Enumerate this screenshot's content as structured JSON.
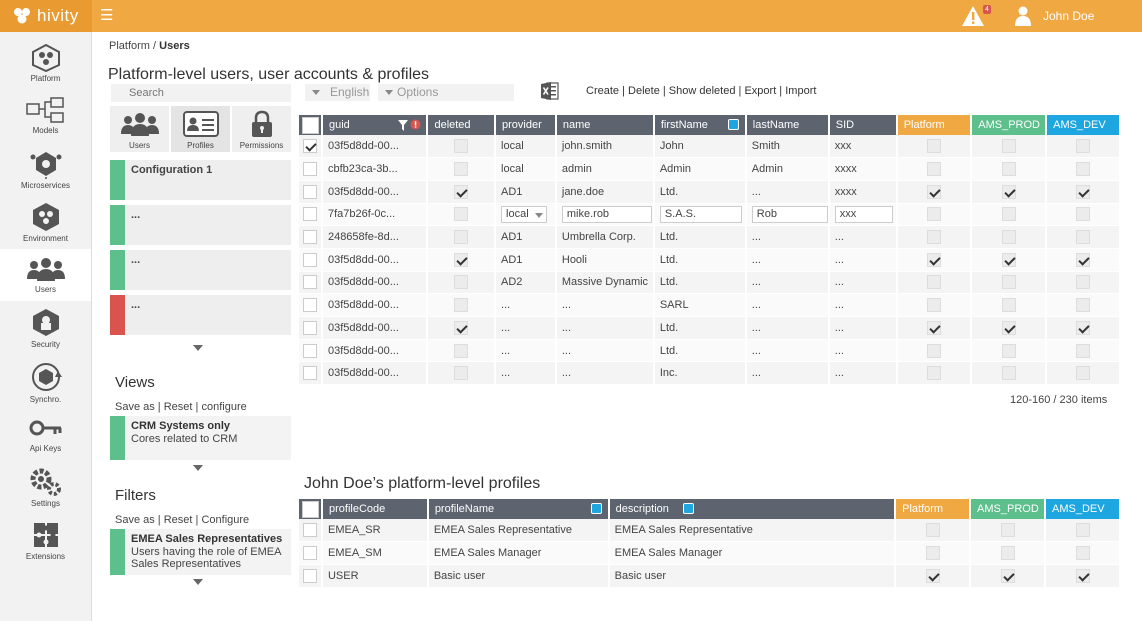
{
  "app": {
    "brand": "hivity",
    "username": "John Doe",
    "alert_count": "4"
  },
  "colors": {
    "topbar": "#f0a843",
    "platform": "#f0a843",
    "ams_prod": "#5cbf8c",
    "ams_dev": "#1da6e0",
    "header": "#5d6470",
    "danger": "#d9534f"
  },
  "sidebar": {
    "items": [
      {
        "label": "Platform",
        "icon": "platform-icon"
      },
      {
        "label": "Models",
        "icon": "models-icon"
      },
      {
        "label": "Microservices",
        "icon": "microservices-icon"
      },
      {
        "label": "Environment",
        "icon": "environment-icon"
      },
      {
        "label": "Users",
        "icon": "users-icon",
        "active": true
      },
      {
        "label": "Security",
        "icon": "security-icon"
      },
      {
        "label": "Synchro.",
        "icon": "synchro-icon"
      },
      {
        "label": "Api Keys",
        "icon": "key-icon"
      },
      {
        "label": "Settings",
        "icon": "gears-icon"
      },
      {
        "label": "Extensions",
        "icon": "puzzle-icon"
      }
    ]
  },
  "breadcrumb": {
    "root": "Platform",
    "sep": " / ",
    "current": "Users"
  },
  "page_title": "Platform-level users, user accounts & profiles",
  "search": {
    "placeholder": "Search"
  },
  "left_tabs": [
    {
      "label": "Users"
    },
    {
      "label": "Profiles"
    },
    {
      "label": "Permissions"
    }
  ],
  "configurations": [
    {
      "title": "Configuration 1",
      "color": "#5cbf8c"
    },
    {
      "title": "...",
      "color": "#5cbf8c"
    },
    {
      "title": "...",
      "color": "#5cbf8c"
    },
    {
      "title": "...",
      "color": "#d9534f"
    }
  ],
  "views": {
    "title": "Views",
    "save_as": "Save as",
    "reset": "Reset",
    "configure": "configure",
    "sep": " | ",
    "item": {
      "title": "CRM Systems only",
      "desc": "Cores related to CRM"
    }
  },
  "filters": {
    "title": "Filters",
    "save_as": "Save as",
    "reset": "Reset",
    "configure": "Configure",
    "sep": " | ",
    "item": {
      "title": "EMEA Sales Representatives",
      "desc": "Users having the role of EMEA Sales Representatives"
    }
  },
  "toolbar": {
    "language": "English",
    "options": "Options",
    "create": "Create",
    "delete": "Delete",
    "show_deleted": "Show deleted",
    "export": "Export",
    "import": "Import",
    "sep": " | "
  },
  "users_table": {
    "headers": [
      "guid",
      "deleted",
      "provider",
      "name",
      "firstName",
      "lastName",
      "SID",
      "Platform",
      "AMS_PROD",
      "AMS_DEV"
    ],
    "rows": [
      {
        "checked": true,
        "guid": "03f5d8dd-00...",
        "deleted": false,
        "provider": "local",
        "name": "john.smith",
        "firstName": "John",
        "lastName": "Smith",
        "sid": "xxx",
        "platform": false,
        "ams_prod": false,
        "ams_dev": false
      },
      {
        "checked": false,
        "guid": "cbfb23ca-3b...",
        "deleted": false,
        "provider": "local",
        "name": "admin",
        "firstName": "Admin",
        "lastName": "Admin",
        "sid": "xxxx",
        "platform": false,
        "ams_prod": false,
        "ams_dev": false
      },
      {
        "checked": false,
        "guid": "03f5d8dd-00...",
        "deleted": true,
        "provider": "AD1",
        "name": "jane.doe",
        "firstName": "Ltd.",
        "lastName": "...",
        "sid": "xxxx",
        "platform": true,
        "ams_prod": true,
        "ams_dev": true
      },
      {
        "checked": false,
        "guid": "7fa7b26f-0c...",
        "deleted": false,
        "provider": "local",
        "name": "mike.rob",
        "firstName": "S.A.S.",
        "lastName": "Rob",
        "sid": "xxx",
        "platform": false,
        "ams_prod": false,
        "ams_dev": false,
        "editing": true
      },
      {
        "checked": false,
        "guid": "248658fe-8d...",
        "deleted": false,
        "provider": "AD1",
        "name": "Umbrella Corp.",
        "firstName": "Ltd.",
        "lastName": "...",
        "sid": "...",
        "platform": false,
        "ams_prod": false,
        "ams_dev": false
      },
      {
        "checked": false,
        "guid": "03f5d8dd-00...",
        "deleted": true,
        "provider": "AD1",
        "name": "Hooli",
        "firstName": "Ltd.",
        "lastName": "...",
        "sid": "...",
        "platform": true,
        "ams_prod": true,
        "ams_dev": true
      },
      {
        "checked": false,
        "guid": "03f5d8dd-00...",
        "deleted": false,
        "provider": "AD2",
        "name": "Massive Dynamic",
        "firstName": "Ltd.",
        "lastName": "...",
        "sid": "...",
        "platform": false,
        "ams_prod": false,
        "ams_dev": false
      },
      {
        "checked": false,
        "guid": "03f5d8dd-00...",
        "deleted": false,
        "provider": "...",
        "name": "...",
        "firstName": "SARL",
        "lastName": "...",
        "sid": "...",
        "platform": false,
        "ams_prod": false,
        "ams_dev": false
      },
      {
        "checked": false,
        "guid": "03f5d8dd-00...",
        "deleted": true,
        "provider": "...",
        "name": "...",
        "firstName": "Ltd.",
        "lastName": "...",
        "sid": "...",
        "platform": true,
        "ams_prod": true,
        "ams_dev": true
      },
      {
        "checked": false,
        "guid": "03f5d8dd-00...",
        "deleted": false,
        "provider": "...",
        "name": "...",
        "firstName": "Ltd.",
        "lastName": "...",
        "sid": "...",
        "platform": false,
        "ams_prod": false,
        "ams_dev": false
      },
      {
        "checked": false,
        "guid": "03f5d8dd-00...",
        "deleted": false,
        "provider": "...",
        "name": "...",
        "firstName": "Inc.",
        "lastName": "...",
        "sid": "...",
        "platform": false,
        "ams_prod": false,
        "ams_dev": false
      }
    ]
  },
  "pagination": "120-160 / 230 items",
  "profiles_title": "John Doe’s platform-level profiles",
  "profiles_table": {
    "headers": [
      "profileCode",
      "profileName",
      "description",
      "Platform",
      "AMS_PROD",
      "AMS_DEV"
    ],
    "rows": [
      {
        "code": "EMEA_SR",
        "name": "EMEA Sales Representative",
        "description": "EMEA Sales Representative",
        "platform": false,
        "ams_prod": false,
        "ams_dev": false
      },
      {
        "code": "EMEA_SM",
        "name": "EMEA Sales Manager",
        "description": "EMEA Sales Manager",
        "platform": false,
        "ams_prod": false,
        "ams_dev": false
      },
      {
        "code": "USER",
        "name": "Basic user",
        "description": "Basic user",
        "platform": true,
        "ams_prod": true,
        "ams_dev": true
      }
    ]
  }
}
